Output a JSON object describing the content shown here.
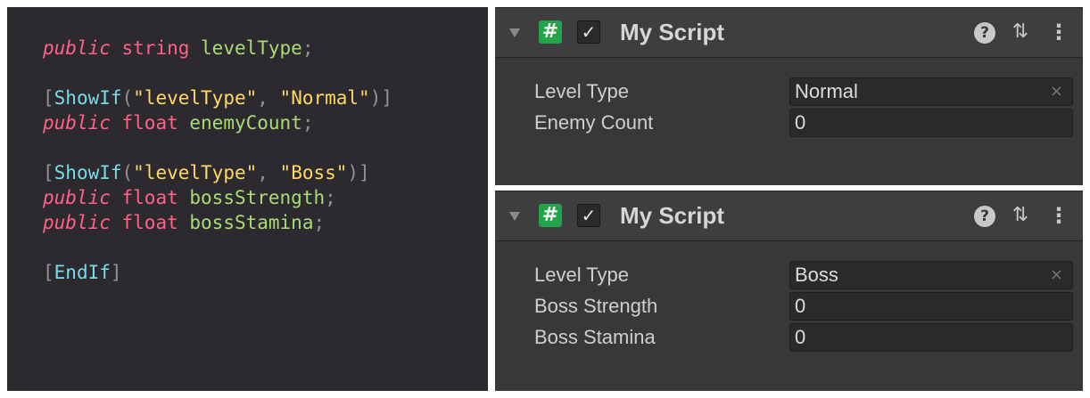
{
  "code": {
    "lines": [
      [
        {
          "t": "public",
          "c": "kw"
        },
        {
          "t": " ",
          "c": ""
        },
        {
          "t": "string",
          "c": "ty"
        },
        {
          "t": " ",
          "c": ""
        },
        {
          "t": "levelType",
          "c": "id"
        },
        {
          "t": ";",
          "c": "pun"
        }
      ],
      [],
      [
        {
          "t": "[",
          "c": "pun"
        },
        {
          "t": "ShowIf",
          "c": "fn"
        },
        {
          "t": "(",
          "c": "pun"
        },
        {
          "t": "\"levelType\"",
          "c": "str"
        },
        {
          "t": ", ",
          "c": "pun"
        },
        {
          "t": "\"Normal\"",
          "c": "str"
        },
        {
          "t": ")]",
          "c": "pun"
        }
      ],
      [
        {
          "t": "public",
          "c": "kw"
        },
        {
          "t": " ",
          "c": ""
        },
        {
          "t": "float",
          "c": "ty"
        },
        {
          "t": " ",
          "c": ""
        },
        {
          "t": "enemyCount",
          "c": "id"
        },
        {
          "t": ";",
          "c": "pun"
        }
      ],
      [],
      [
        {
          "t": "[",
          "c": "pun"
        },
        {
          "t": "ShowIf",
          "c": "fn"
        },
        {
          "t": "(",
          "c": "pun"
        },
        {
          "t": "\"levelType\"",
          "c": "str"
        },
        {
          "t": ", ",
          "c": "pun"
        },
        {
          "t": "\"Boss\"",
          "c": "str"
        },
        {
          "t": ")]",
          "c": "pun"
        }
      ],
      [
        {
          "t": "public",
          "c": "kw"
        },
        {
          "t": " ",
          "c": ""
        },
        {
          "t": "float",
          "c": "ty"
        },
        {
          "t": " ",
          "c": ""
        },
        {
          "t": "bossStrength",
          "c": "id"
        },
        {
          "t": ";",
          "c": "pun"
        }
      ],
      [
        {
          "t": "public",
          "c": "kw"
        },
        {
          "t": " ",
          "c": ""
        },
        {
          "t": "float",
          "c": "ty"
        },
        {
          "t": " ",
          "c": ""
        },
        {
          "t": "bossStamina",
          "c": "id"
        },
        {
          "t": ";",
          "c": "pun"
        }
      ],
      [],
      [
        {
          "t": "[",
          "c": "pun"
        },
        {
          "t": "EndIf",
          "c": "fn"
        },
        {
          "t": "]",
          "c": "pun"
        }
      ]
    ]
  },
  "inspector_top": {
    "title": "My Script",
    "script_icon_glyph": "#",
    "checkbox_glyph": "✓",
    "help_glyph": "?",
    "preset_glyph": "⇅",
    "menu_glyph": "⋮",
    "fields": [
      {
        "label": "Level Type",
        "value": "Normal",
        "clear": "×"
      },
      {
        "label": "Enemy Count",
        "value": "0",
        "clear": ""
      }
    ]
  },
  "inspector_bottom": {
    "title": "My Script",
    "script_icon_glyph": "#",
    "checkbox_glyph": "✓",
    "help_glyph": "?",
    "preset_glyph": "⇅",
    "menu_glyph": "⋮",
    "fields": [
      {
        "label": "Level Type",
        "value": "Boss",
        "clear": "×"
      },
      {
        "label": "Boss Strength",
        "value": "0",
        "clear": ""
      },
      {
        "label": "Boss Stamina",
        "value": "0",
        "clear": ""
      }
    ]
  },
  "colors": {
    "code_bg": "#2c2a2e",
    "keyword": "#ff6188",
    "attribute": "#78dce8",
    "identifier": "#a9dc76",
    "string": "#ffd866",
    "inspector_bg": "#383838",
    "field_bg": "#2a2a2a",
    "script_icon": "#24a44a"
  },
  "icons": [
    "foldout-triangle-icon",
    "csharp-script-icon",
    "checkbox-icon",
    "help-icon",
    "preset-icon",
    "kebab-menu-icon",
    "clear-icon"
  ]
}
